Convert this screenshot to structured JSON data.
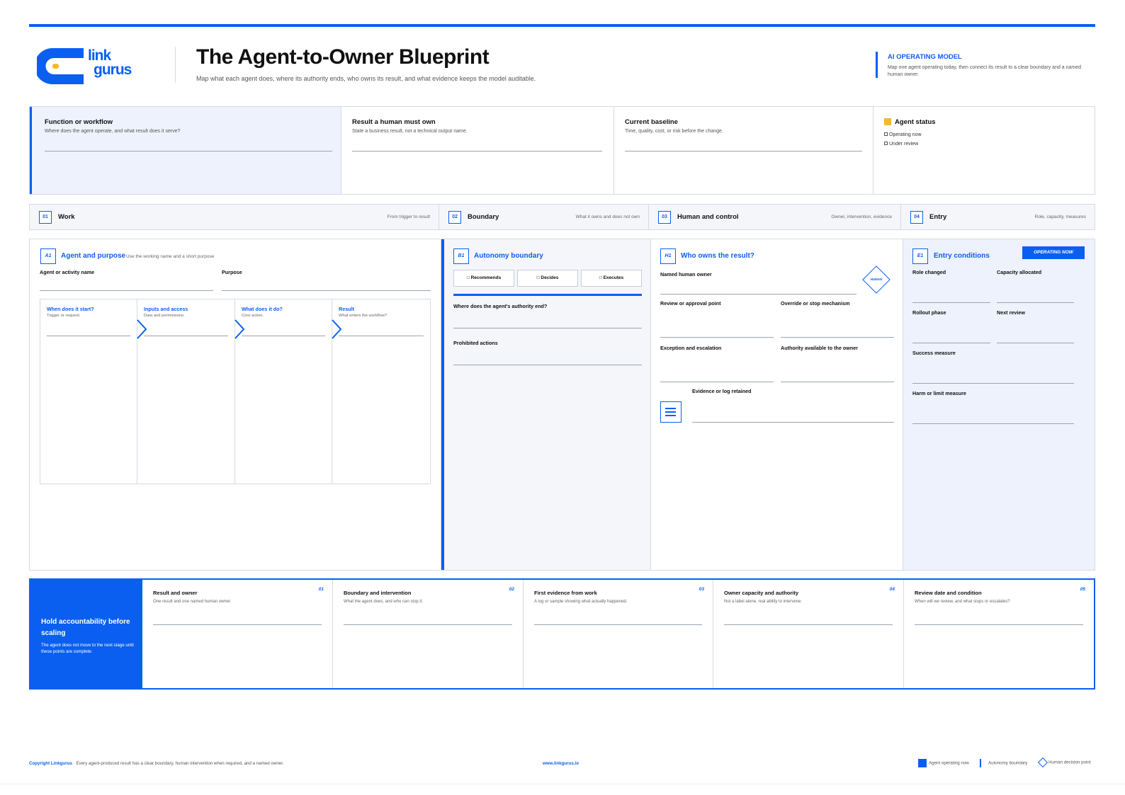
{
  "header": {
    "logo_text_top": "link",
    "logo_text_bottom": "gurus",
    "title": "The Agent-to-Owner Blueprint",
    "subtitle": "Map what each agent does, where its authority ends, who owns its result, and what evidence keeps the model auditable.",
    "model_label": "AI OPERATING MODEL",
    "model_text": "Map one agent operating today, then connect its result to a clear boundary and a named human owner."
  },
  "summary": {
    "function_title": "Function or workflow",
    "function_hint": "Where does the agent operate, and what result does it serve?",
    "result_title": "Result a human must own",
    "result_hint": "State a business result, not a technical output name.",
    "baseline_title": "Current baseline",
    "baseline_hint": "Time, quality, cost, or risk before the change.",
    "status_title": "Agent status",
    "status_options": [
      "Operating now",
      "Under review"
    ]
  },
  "sections": [
    {
      "num": "01",
      "name": "Work",
      "desc": "From trigger to result"
    },
    {
      "num": "02",
      "name": "Boundary",
      "desc": "What it owns and does not own"
    },
    {
      "num": "03",
      "name": "Human and control",
      "desc": "Owner, intervention, evidence"
    },
    {
      "num": "04",
      "name": "Entry",
      "desc": "Role, capacity, measures"
    }
  ],
  "work": {
    "badge": "A1",
    "title": "Agent and purpose",
    "hint": "Use the working name and a short purpose",
    "name_label": "Agent or activity name",
    "purpose_label": "Purpose",
    "stages": [
      {
        "title": "When does it start?",
        "hint": "Trigger or request."
      },
      {
        "title": "Inputs and access",
        "hint": "Data and permissions."
      },
      {
        "title": "What does it do?",
        "hint": "Core action."
      },
      {
        "title": "Result",
        "hint": "What enters the workflow?"
      }
    ]
  },
  "boundary": {
    "badge": "B1",
    "title": "Autonomy boundary",
    "options": [
      "Recommends",
      "Decides",
      "Executes"
    ],
    "authority_label": "Where does the agent's authority end?",
    "prohibited_label": "Prohibited actions"
  },
  "human": {
    "badge": "H1",
    "title": "Who owns the result?",
    "owner_label": "Named human owner",
    "diamond_label": "HUMAN",
    "review_label": "Review or approval point",
    "override_label": "Override or stop mechanism",
    "exception_label": "Exception and escalation",
    "authority_label": "Authority available to the owner",
    "evidence_label": "Evidence or log retained"
  },
  "entry": {
    "badge": "E1",
    "title": "Entry conditions",
    "tag": "OPERATING NOW",
    "role_label": "Role changed",
    "capacity_label": "Capacity allocated",
    "rollout_label": "Rollout phase",
    "next_review_label": "Next review",
    "success_label": "Success measure",
    "harm_label": "Harm or limit measure"
  },
  "accountability": {
    "title": "Hold accountability before scaling",
    "text": "The agent does not move to the next stage until these points are complete.",
    "items": [
      {
        "num": "01",
        "title": "Result and owner",
        "hint": "One result and one named human owner."
      },
      {
        "num": "02",
        "title": "Boundary and intervention",
        "hint": "What the agent does, and who can stop it."
      },
      {
        "num": "03",
        "title": "First evidence from work",
        "hint": "A log or sample showing what actually happened."
      },
      {
        "num": "04",
        "title": "Owner capacity and authority",
        "hint": "Not a label alone, real ability to intervene."
      },
      {
        "num": "05",
        "title": "Review date and condition",
        "hint": "When will we review, and what stops or escalates?"
      }
    ]
  },
  "footer": {
    "copyright_brand": "Copyright Linkgurus",
    "copyright_text": "· Every agent-produced result has a clear boundary, human intervention when required, and a named owner.",
    "url": "www.linkgurus.io",
    "legend": [
      "Agent operating now",
      "Autonomy boundary",
      "Human decision point"
    ]
  },
  "colors": {
    "accent": "#0a5ff0",
    "status": "#f5b82e",
    "panel_tint": "#edf2fd"
  }
}
